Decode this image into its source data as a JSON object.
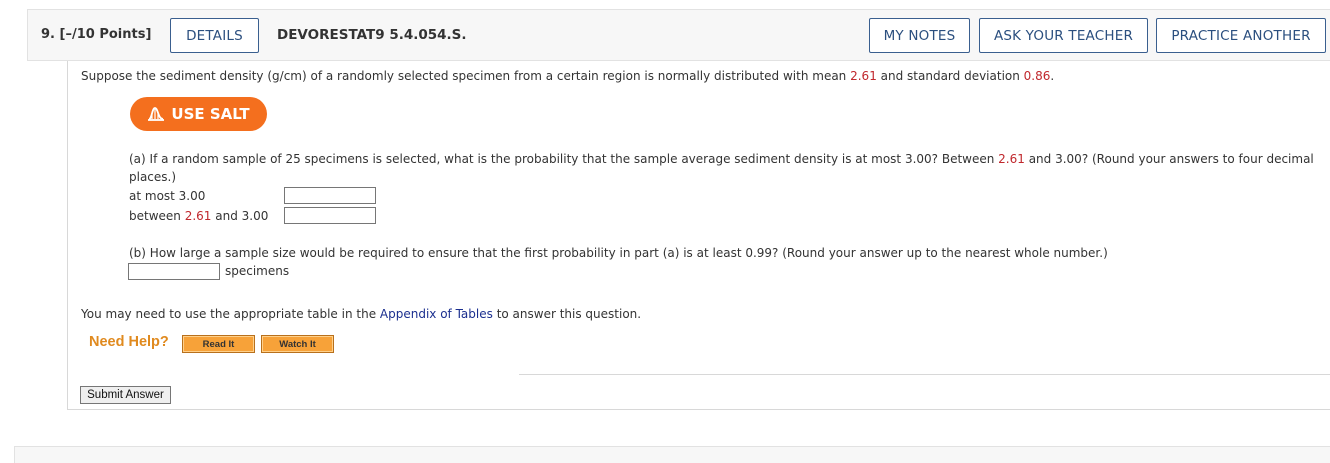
{
  "header": {
    "question_number": "9.  [–/10 Points]",
    "details_label": "DETAILS",
    "reference": "DEVORESTAT9 5.4.054.S.",
    "my_notes_label": "MY NOTES",
    "ask_teacher_label": "ASK YOUR TEACHER",
    "practice_another_label": "PRACTICE ANOTHER"
  },
  "prompt": {
    "text_1": "Suppose the sediment density (g/cm) of a randomly selected specimen from a certain region is normally distributed with mean ",
    "mean": "2.61",
    "text_2": " and standard deviation ",
    "sd": "0.86",
    "text_3": "."
  },
  "salt_button": {
    "label": "USE SALT",
    "color": "#f46f1e"
  },
  "part_a": {
    "line_1_text_1": "(a) If a random sample of 25 specimens is selected, what is the probability that the sample average sediment density is at most 3.00? Between ",
    "line_1_value": "2.61",
    "line_1_text_2": " and 3.00? (Round your answers to four decimal",
    "line_2": "places.)",
    "row_1_label": "at most 3.00",
    "row_2_text_1": "between ",
    "row_2_value": "2.61",
    "row_2_text_2": " and 3.00"
  },
  "part_b": {
    "question": "(b) How large a sample size would be required to ensure that the first probability in part (a) is at least 0.99? (Round your answer up to the nearest whole number.)",
    "unit": "specimens"
  },
  "footer": {
    "text_1": "You may need to use the appropriate table in the ",
    "link": "Appendix of Tables",
    "text_2": " to answer this question.",
    "need_help": "Need Help?",
    "read_it": "Read It",
    "watch_it": "Watch It",
    "submit": "Submit Answer"
  },
  "colors": {
    "accent_red": "#c0282d",
    "link_blue": "#1b2f8f",
    "button_border": "#3a5f8f",
    "help_orange": "#f7a239"
  }
}
